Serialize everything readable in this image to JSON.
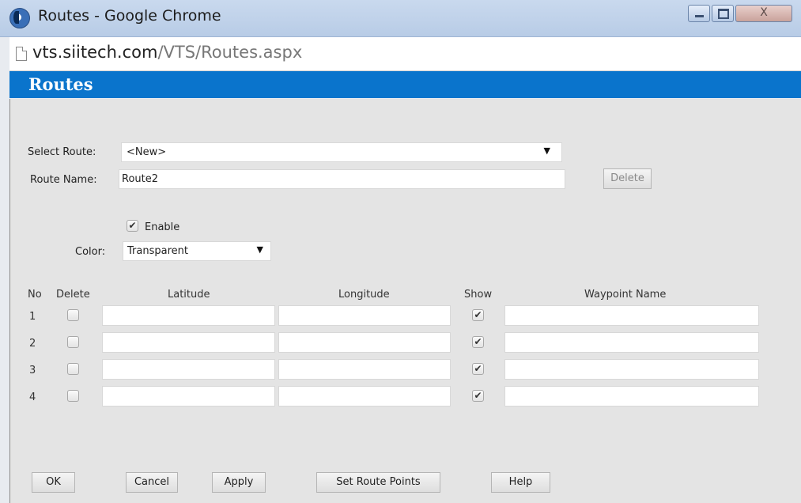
{
  "window": {
    "title": "Routes - Google Chrome",
    "close_glyph": "X"
  },
  "address": {
    "host": "vts.siitech.com",
    "path": "/VTS/Routes.aspx"
  },
  "header": {
    "title": "Routes"
  },
  "form": {
    "select_route_label": "Select Route:",
    "select_route_value": "<New>",
    "route_name_label": "Route Name:",
    "route_name_value": "Route2",
    "delete_button": "Delete",
    "enable_label": "Enable",
    "enable_checked": true,
    "color_label": "Color:",
    "color_value": "Transparent"
  },
  "table": {
    "headers": [
      "No",
      "Delete",
      "Latitude",
      "Longitude",
      "Show",
      "Waypoint Name"
    ],
    "rows": [
      {
        "no": "1",
        "delete": false,
        "latitude": "",
        "longitude": "",
        "show": true,
        "waypoint": ""
      },
      {
        "no": "2",
        "delete": false,
        "latitude": "",
        "longitude": "",
        "show": true,
        "waypoint": ""
      },
      {
        "no": "3",
        "delete": false,
        "latitude": "",
        "longitude": "",
        "show": true,
        "waypoint": ""
      },
      {
        "no": "4",
        "delete": false,
        "latitude": "",
        "longitude": "",
        "show": true,
        "waypoint": ""
      }
    ]
  },
  "buttons": {
    "ok": "OK",
    "cancel": "Cancel",
    "apply": "Apply",
    "set_route_points": "Set Route Points",
    "help": "Help"
  },
  "icons": {
    "checkmark": "✔",
    "dropdown": "▼"
  },
  "colors": {
    "header_blue": "#0a74cc",
    "panel_gray": "#e4e4e4",
    "titlebar": "#c9d9ee"
  }
}
